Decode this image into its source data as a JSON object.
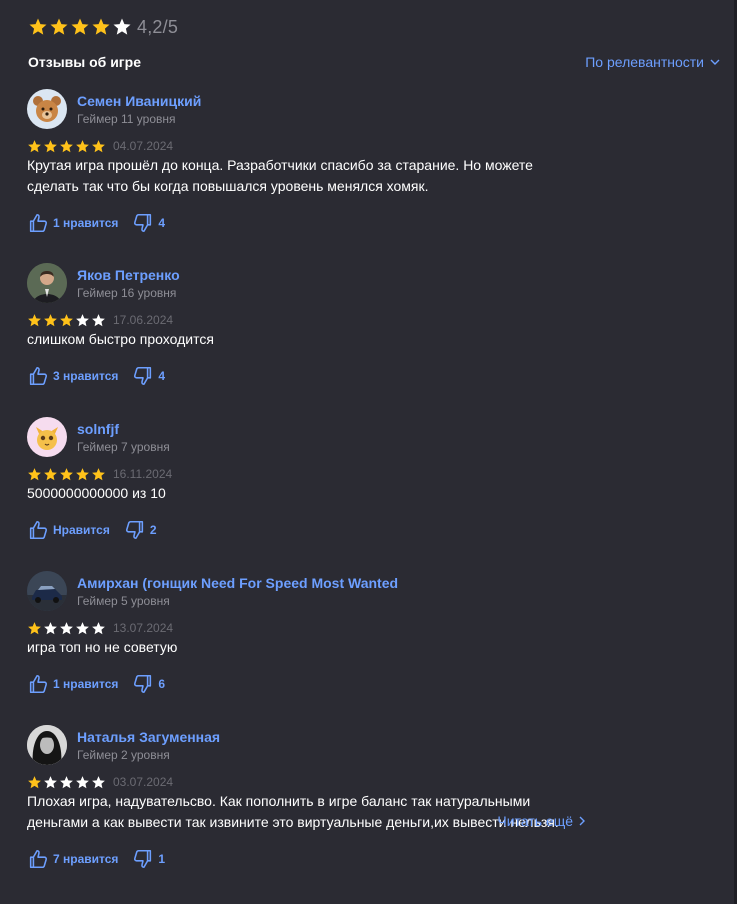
{
  "colors": {
    "background": "#2b2b33",
    "accent": "#6d9fff",
    "star_filled": "#ffc21a",
    "star_empty": "#ffffff",
    "muted": "#8e8e96"
  },
  "summary": {
    "rating": 4.2,
    "score_text": "4,2/5"
  },
  "section": {
    "title": "Отзывы об игре",
    "sort_label": "По релевантности"
  },
  "reviews": [
    {
      "author": "Семен Иваницкий",
      "level": "Геймер 11 уровня",
      "avatar": "bear-emoji-avatar",
      "rating": 5,
      "date": "04.07.2024",
      "text": "Крутая игра прошёл до конца. Разработчики спасибо за старание. Но можете сделать так что бы когда повышался уровень менялся хомяк.",
      "likes_label": "1 нравится",
      "dislikes": "4"
    },
    {
      "author": "Яков Петренко",
      "level": "Геймер 16 уровня",
      "avatar": "person-photo-avatar",
      "rating": 3,
      "date": "17.06.2024",
      "text": "слишком быстро проходится",
      "likes_label": "3 нравится",
      "dislikes": "4"
    },
    {
      "author": "solnfjf",
      "level": "Геймер 7 уровня",
      "avatar": "cat-emoji-avatar",
      "rating": 5,
      "date": "16.11.2024",
      "text": "5000000000000 из 10",
      "likes_label": "Нравится",
      "dislikes": "2"
    },
    {
      "author": "Амирхан (гонщик Need For Speed Most Wanted",
      "level": "Геймер 5 уровня",
      "avatar": "car-photo-avatar",
      "rating": 1,
      "date": "13.07.2024",
      "text": "игра топ но не советую",
      "likes_label": "1 нравится",
      "dislikes": "6"
    },
    {
      "author": "Наталья Загуменная",
      "level": "Геймер 2 уровня",
      "avatar": "woman-photo-avatar",
      "rating": 1,
      "date": "03.07.2024",
      "text": "Плохая игра, надувательсво. Как пополнить в игре баланс так натуральными деньгами а как вывести так извините это виртуальные деньги,их вывести нельзя.",
      "read_more": "Читать ещё",
      "likes_label": "7 нравится",
      "dislikes": "1"
    }
  ]
}
